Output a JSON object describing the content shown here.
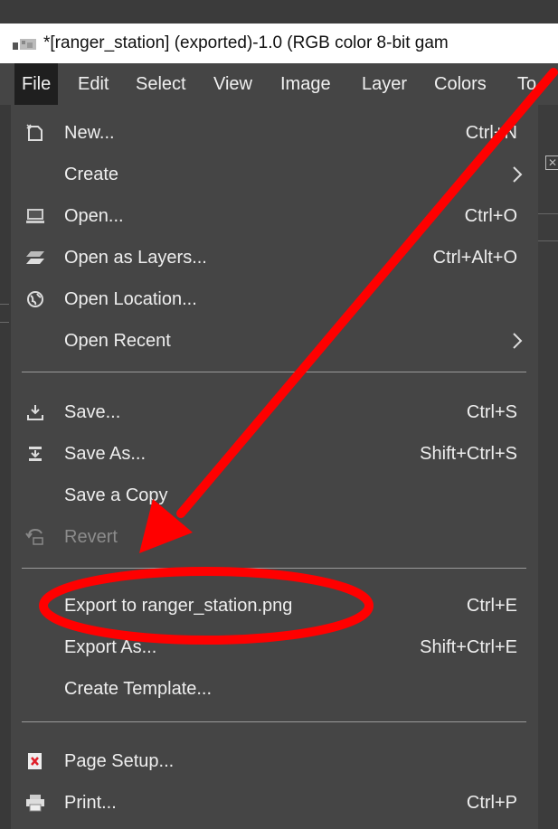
{
  "window": {
    "title": "*[ranger_station] (exported)-1.0 (RGB color 8-bit gam"
  },
  "menubar": {
    "items": [
      "File",
      "Edit",
      "Select",
      "View",
      "Image",
      "Layer",
      "Colors",
      "To"
    ]
  },
  "file_menu": {
    "new": {
      "label": "New...",
      "shortcut": "Ctrl+N"
    },
    "create": {
      "label": "Create"
    },
    "open": {
      "label": "Open...",
      "shortcut": "Ctrl+O"
    },
    "open_as_layers": {
      "label": "Open as Layers...",
      "shortcut": "Ctrl+Alt+O"
    },
    "open_location": {
      "label": "Open Location..."
    },
    "open_recent": {
      "label": "Open Recent"
    },
    "save": {
      "label": "Save...",
      "shortcut": "Ctrl+S"
    },
    "save_as": {
      "label": "Save As...",
      "shortcut": "Shift+Ctrl+S"
    },
    "save_copy": {
      "label": "Save a Copy"
    },
    "revert": {
      "label": "Revert"
    },
    "export_to": {
      "label": "Export to ranger_station.png",
      "shortcut": "Ctrl+E"
    },
    "export_as": {
      "label": "Export As...",
      "shortcut": "Shift+Ctrl+E"
    },
    "create_template": {
      "label": "Create Template..."
    },
    "page_setup": {
      "label": "Page Setup..."
    },
    "print": {
      "label": "Print...",
      "shortcut": "Ctrl+P"
    }
  },
  "annotation": {
    "color": "#ff0000"
  }
}
